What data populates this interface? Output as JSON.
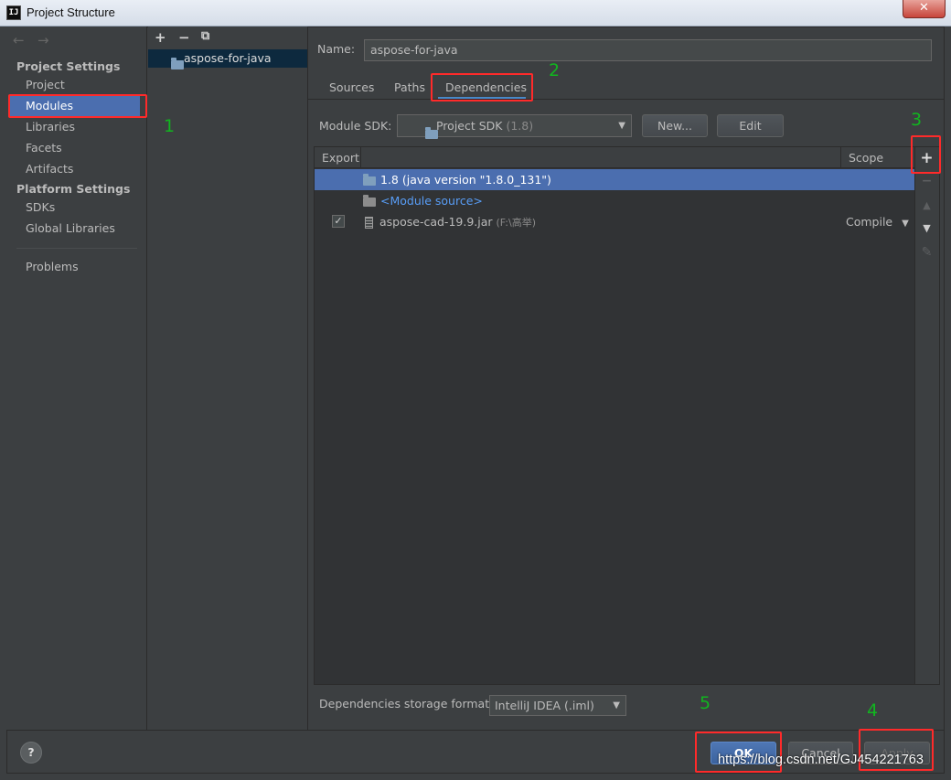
{
  "window": {
    "title": "Project Structure",
    "app_icon_text": "IJ",
    "close_glyph": "✕"
  },
  "sidebar": {
    "nav_back": "←",
    "nav_forward": "→",
    "project_settings_header": "Project Settings",
    "project_items": [
      "Project",
      "Modules",
      "Libraries",
      "Facets",
      "Artifacts"
    ],
    "platform_settings_header": "Platform Settings",
    "platform_items": [
      "SDKs",
      "Global Libraries"
    ],
    "problems": "Problems",
    "selected": "Modules"
  },
  "module_list": {
    "toolbar": {
      "add": "+",
      "remove": "−",
      "copy": "⧉"
    },
    "items": [
      "aspose-for-java"
    ]
  },
  "module": {
    "name_label": "Name:",
    "name_value": "aspose-for-java",
    "tabs": [
      "Sources",
      "Paths",
      "Dependencies"
    ],
    "active_tab": "Dependencies",
    "sdk_label": "Module SDK:",
    "sdk_value": "Project SDK",
    "sdk_version": "(1.8)",
    "new_button": "New...",
    "edit_button": "Edit"
  },
  "dependencies_table": {
    "headers": {
      "export": "Export",
      "scope": "Scope"
    },
    "rows": [
      {
        "name": "1.8 (java version \"1.8.0_131\")",
        "path": "",
        "scope": "",
        "checked": false,
        "selected": true
      },
      {
        "name": "<Module source>",
        "path": "",
        "scope": "",
        "checked": false,
        "selected": false
      },
      {
        "name": "aspose-cad-19.9.jar",
        "path": "(F:\\高举)",
        "scope": "Compile",
        "checked": true,
        "selected": false
      }
    ],
    "side_toolbar": {
      "add": "+",
      "remove": "−",
      "up": "▲",
      "down": "▼",
      "edit": "✎"
    }
  },
  "storage_format": {
    "label": "Dependencies storage format:",
    "value": "IntelliJ IDEA (.iml)"
  },
  "footer": {
    "help": "?",
    "ok": "OK",
    "cancel": "Cancel",
    "apply": "Apply"
  },
  "annotations": {
    "n1": "1",
    "n2": "2",
    "n3": "3",
    "n4": "4",
    "n5": "5"
  },
  "watermark": "https://blog.csdn.net/GJ454221763",
  "colors": {
    "background": "#3c3f41",
    "selection": "#4b6eaf",
    "annotation_red": "#ff2a2a",
    "annotation_green": "#11b51f"
  }
}
